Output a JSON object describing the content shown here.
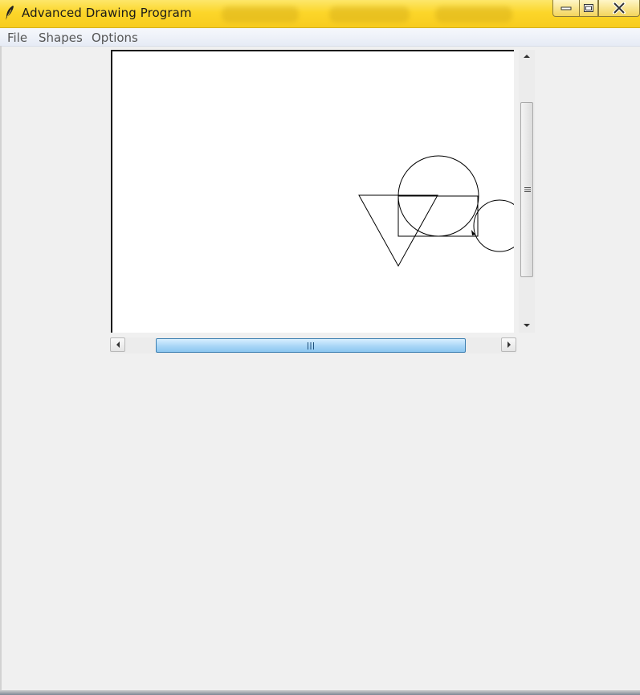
{
  "window": {
    "title": "Advanced Drawing Program",
    "icon": "feather-icon"
  },
  "menubar": {
    "items": [
      "File",
      "Shapes",
      "Options"
    ]
  },
  "canvas": {
    "shapes": [
      "triangle",
      "circle",
      "rectangle",
      "circle"
    ]
  },
  "colors": {
    "titlebar": "#fcd62a",
    "canvas_bg": "#ffffff",
    "stroke": "#000000",
    "scroll_thumb": "#a9d6f7"
  }
}
